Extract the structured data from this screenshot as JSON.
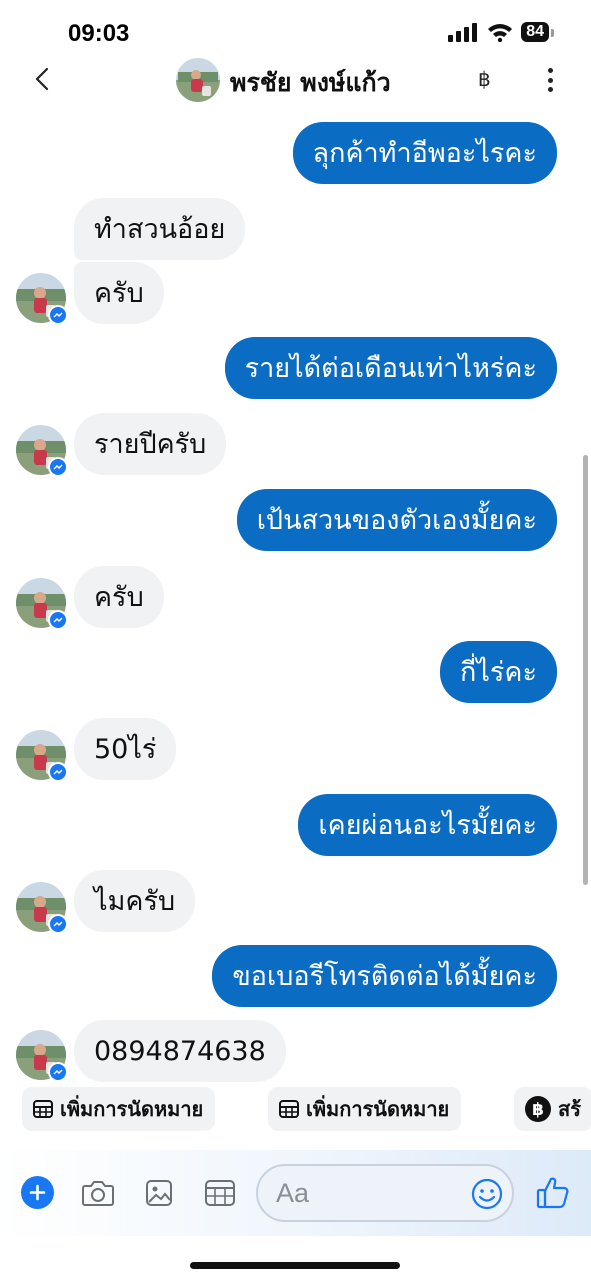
{
  "status_bar": {
    "time": "09:03",
    "battery": "84"
  },
  "header": {
    "contact_name": "พรชัย พงษ์แก้ว",
    "baht_symbol": "฿"
  },
  "messages": [
    {
      "dir": "out",
      "text": "ลุกค้าทำอีพอะไรคะ"
    },
    {
      "dir": "in",
      "text": "ทำสวนอ้อย"
    },
    {
      "dir": "in",
      "text": "ครับ"
    },
    {
      "dir": "out",
      "text": "รายได้ต่อเดือนเท่าไหร่คะ"
    },
    {
      "dir": "in",
      "text": "รายปีครับ"
    },
    {
      "dir": "out",
      "text": "เป้นสวนของตัวเองมั้ยคะ"
    },
    {
      "dir": "in",
      "text": "ครับ"
    },
    {
      "dir": "out",
      "text": "กี่ไร่คะ"
    },
    {
      "dir": "in",
      "text": "50ไร่"
    },
    {
      "dir": "out",
      "text": "เคยผ่อนอะไรมั้ยคะ"
    },
    {
      "dir": "in",
      "text": "ไมครับ"
    },
    {
      "dir": "out",
      "text": "ขอเบอรีโทรติดต่อได้มั้ยคะ"
    },
    {
      "dir": "in",
      "text": "0894874638"
    }
  ],
  "quick_actions": [
    {
      "label": "เพิ่มการนัดหมาย",
      "icon": "calendar-grid-icon"
    },
    {
      "label": "เพิ่มการนัดหมาย",
      "icon": "calendar-grid-icon"
    },
    {
      "label": "สร้",
      "icon": "baht-circle-icon"
    }
  ],
  "composer": {
    "placeholder": "Aa"
  },
  "icons": [
    "chevron-left-icon",
    "baht-icon",
    "more-vertical-icon",
    "plus-icon",
    "camera-icon",
    "image-icon",
    "calendar-icon",
    "emoji-icon",
    "thumbs-up-icon",
    "messenger-badge-icon"
  ],
  "colors": {
    "outgoing_bubble": "#0a6cc2",
    "incoming_bubble": "#f1f2f4",
    "accent": "#1877f2"
  }
}
